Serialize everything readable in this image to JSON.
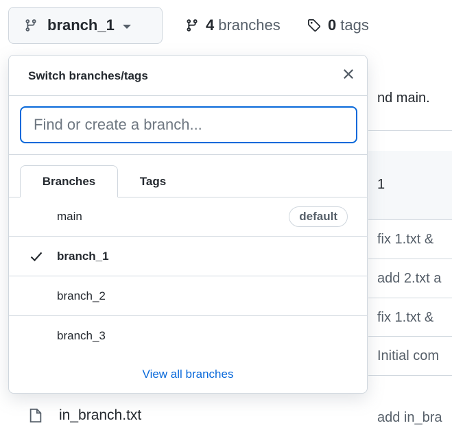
{
  "branch_button": {
    "label": "branch_1"
  },
  "stats": {
    "branch_count": "4",
    "branch_label": "branches",
    "tag_count": "0",
    "tag_label": "tags"
  },
  "background": {
    "notice": "nd main.",
    "header_text": "1",
    "commit_messages": [
      "fix 1.txt &",
      "add 2.txt a",
      "fix 1.txt &",
      "Initial com",
      "add in_bra"
    ],
    "file_name": "in_branch.txt"
  },
  "dropdown": {
    "title": "Switch branches/tags",
    "search_placeholder": "Find or create a branch...",
    "tabs": [
      "Branches",
      "Tags"
    ],
    "branches": [
      {
        "name": "main",
        "badge": "default",
        "selected": false
      },
      {
        "name": "branch_1",
        "badge": "",
        "selected": true
      },
      {
        "name": "branch_2",
        "badge": "",
        "selected": false
      },
      {
        "name": "branch_3",
        "badge": "",
        "selected": false
      }
    ],
    "footer_link": "View all branches"
  },
  "colors": {
    "accent": "#0969da",
    "border": "#d0d7de",
    "muted": "#57606a",
    "text": "#24292f"
  }
}
